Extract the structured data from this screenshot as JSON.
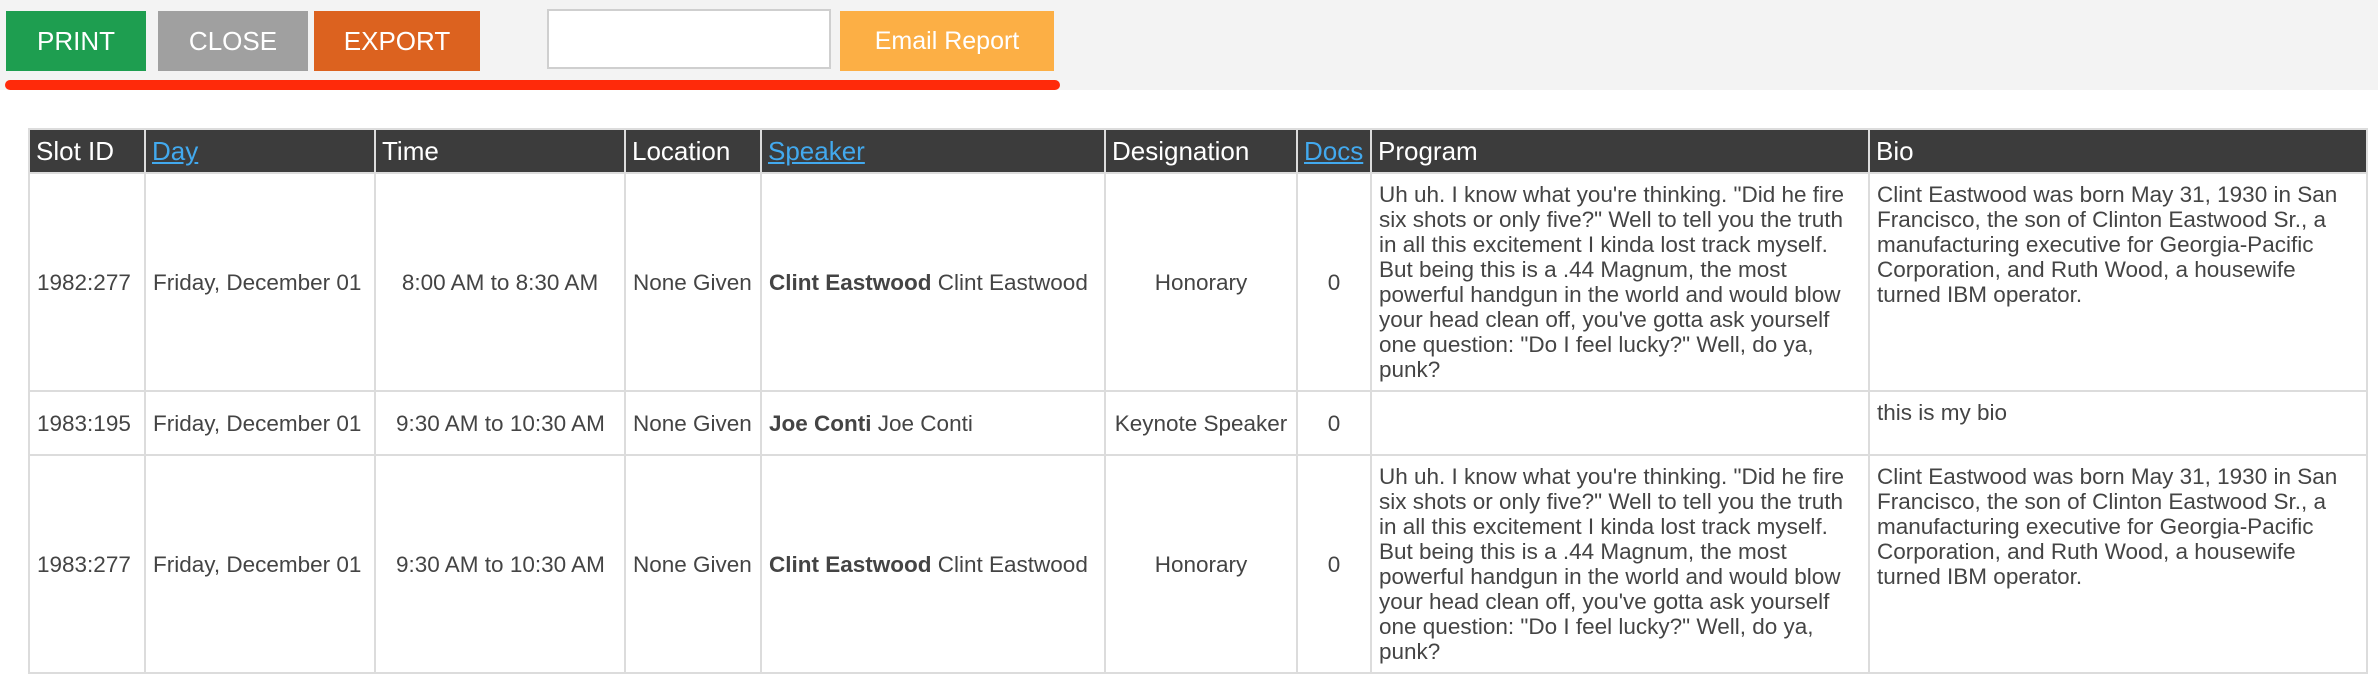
{
  "toolbar": {
    "print_label": "PRINT",
    "close_label": "CLOSE",
    "export_label": "EXPORT",
    "email_input_value": "",
    "email_report_label": "Email Report"
  },
  "table": {
    "headers": {
      "slot_id": "Slot ID",
      "day": "Day",
      "time": "Time",
      "location": "Location",
      "speaker": "Speaker",
      "designation": "Designation",
      "docs": "Docs",
      "program": "Program",
      "bio": "Bio"
    },
    "rows": [
      {
        "slot_id": "1982:277",
        "day": "Friday, December 01",
        "time": "8:00 AM to 8:30 AM",
        "location": "None Given",
        "speaker_bold": "Clint Eastwood",
        "speaker_name": "Clint Eastwood",
        "designation": "Honorary",
        "docs": "0",
        "program": "Uh uh. I know what you're thinking. \"Did he fire six shots or only five?\" Well to tell you the truth in all this excitement I kinda lost track myself. But being this is a .44 Magnum, the most powerful handgun in the world and would blow your head clean off, you've gotta ask yourself one question: \"Do I feel lucky?\" Well, do ya, punk?",
        "bio": "Clint Eastwood was born May 31, 1930 in San Francisco, the son of Clinton Eastwood Sr., a manufacturing executive for Georgia-Pacific Corporation, and Ruth Wood, a housewife turned IBM operator."
      },
      {
        "slot_id": "1983:195",
        "day": "Friday, December 01",
        "time": "9:30 AM to 10:30 AM",
        "location": "None Given",
        "speaker_bold": "Joe Conti",
        "speaker_name": "Joe Conti",
        "designation": "Keynote Speaker",
        "docs": "0",
        "program": "",
        "bio": "this is my bio"
      },
      {
        "slot_id": "1983:277",
        "day": "Friday, December 01",
        "time": "9:30 AM to 10:30 AM",
        "location": "None Given",
        "speaker_bold": "Clint Eastwood",
        "speaker_name": "Clint Eastwood",
        "designation": "Honorary",
        "docs": "0",
        "program": "Uh uh. I know what you're thinking. \"Did he fire six shots or only five?\" Well to tell you the truth in all this excitement I kinda lost track myself. But being this is a .44 Magnum, the most powerful handgun in the world and would blow your head clean off, you've gotta ask yourself one question: \"Do I feel lucky?\" Well, do ya, punk?",
        "bio": "Clint Eastwood was born May 31, 1930 in San Francisco, the son of Clinton Eastwood Sr., a manufacturing executive for Georgia-Pacific Corporation, and Ruth Wood, a housewife turned IBM operator."
      }
    ]
  }
}
